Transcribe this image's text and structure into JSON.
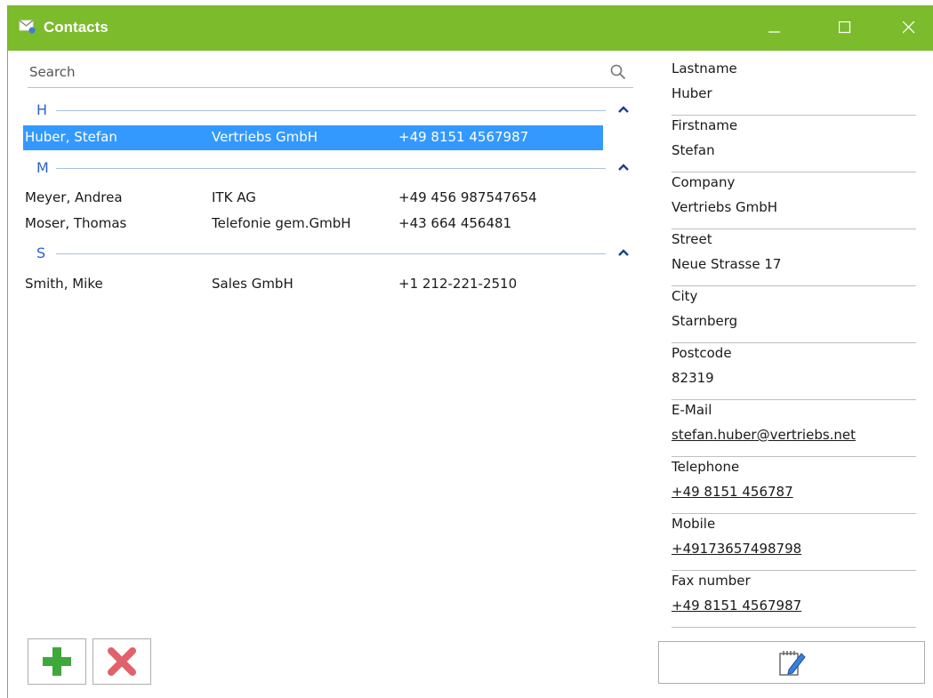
{
  "window": {
    "title": "Contacts",
    "icon": "mail-icon",
    "titlebar_color": "#7bbb2c"
  },
  "search": {
    "placeholder": "Search"
  },
  "groups": [
    {
      "letter": "H",
      "contacts": [
        {
          "name": "Huber, Stefan",
          "company": "Vertriebs GmbH",
          "phone": "+49 8151 4567987",
          "selected": true
        }
      ]
    },
    {
      "letter": "M",
      "contacts": [
        {
          "name": "Meyer, Andrea",
          "company": "ITK AG",
          "phone": "+49 456 987547654"
        },
        {
          "name": "Moser, Thomas",
          "company": "Telefonie gem.GmbH",
          "phone": "+43 664 456481"
        }
      ]
    },
    {
      "letter": "S",
      "contacts": [
        {
          "name": "Smith, Mike",
          "company": "Sales GmbH",
          "phone": "+1 212-221-2510"
        }
      ]
    }
  ],
  "details": {
    "lastname": {
      "label": "Lastname",
      "value": "Huber"
    },
    "firstname": {
      "label": "Firstname",
      "value": "Stefan"
    },
    "company": {
      "label": "Company",
      "value": "Vertriebs GmbH"
    },
    "street": {
      "label": "Street",
      "value": "Neue Strasse 17"
    },
    "city": {
      "label": "City",
      "value": "Starnberg"
    },
    "postcode": {
      "label": "Postcode",
      "value": "82319"
    },
    "email": {
      "label": "E-Mail",
      "value": "stefan.huber@vertriebs.net"
    },
    "telephone": {
      "label": "Telephone",
      "value": "+49 8151 456787"
    },
    "mobile": {
      "label": "Mobile",
      "value": "+49173657498798"
    },
    "fax": {
      "label": "Fax number",
      "value": "+49 8151 4567987"
    }
  },
  "colors": {
    "accent": "#7bbb2c",
    "selection": "#3399ff",
    "group_letter": "#2b62c9",
    "add_icon": "#3fa83a",
    "delete_icon": "#e0636b"
  },
  "icons": {
    "add": "plus-icon",
    "delete": "x-icon",
    "edit": "edit-notepad-icon",
    "search": "search-icon"
  }
}
